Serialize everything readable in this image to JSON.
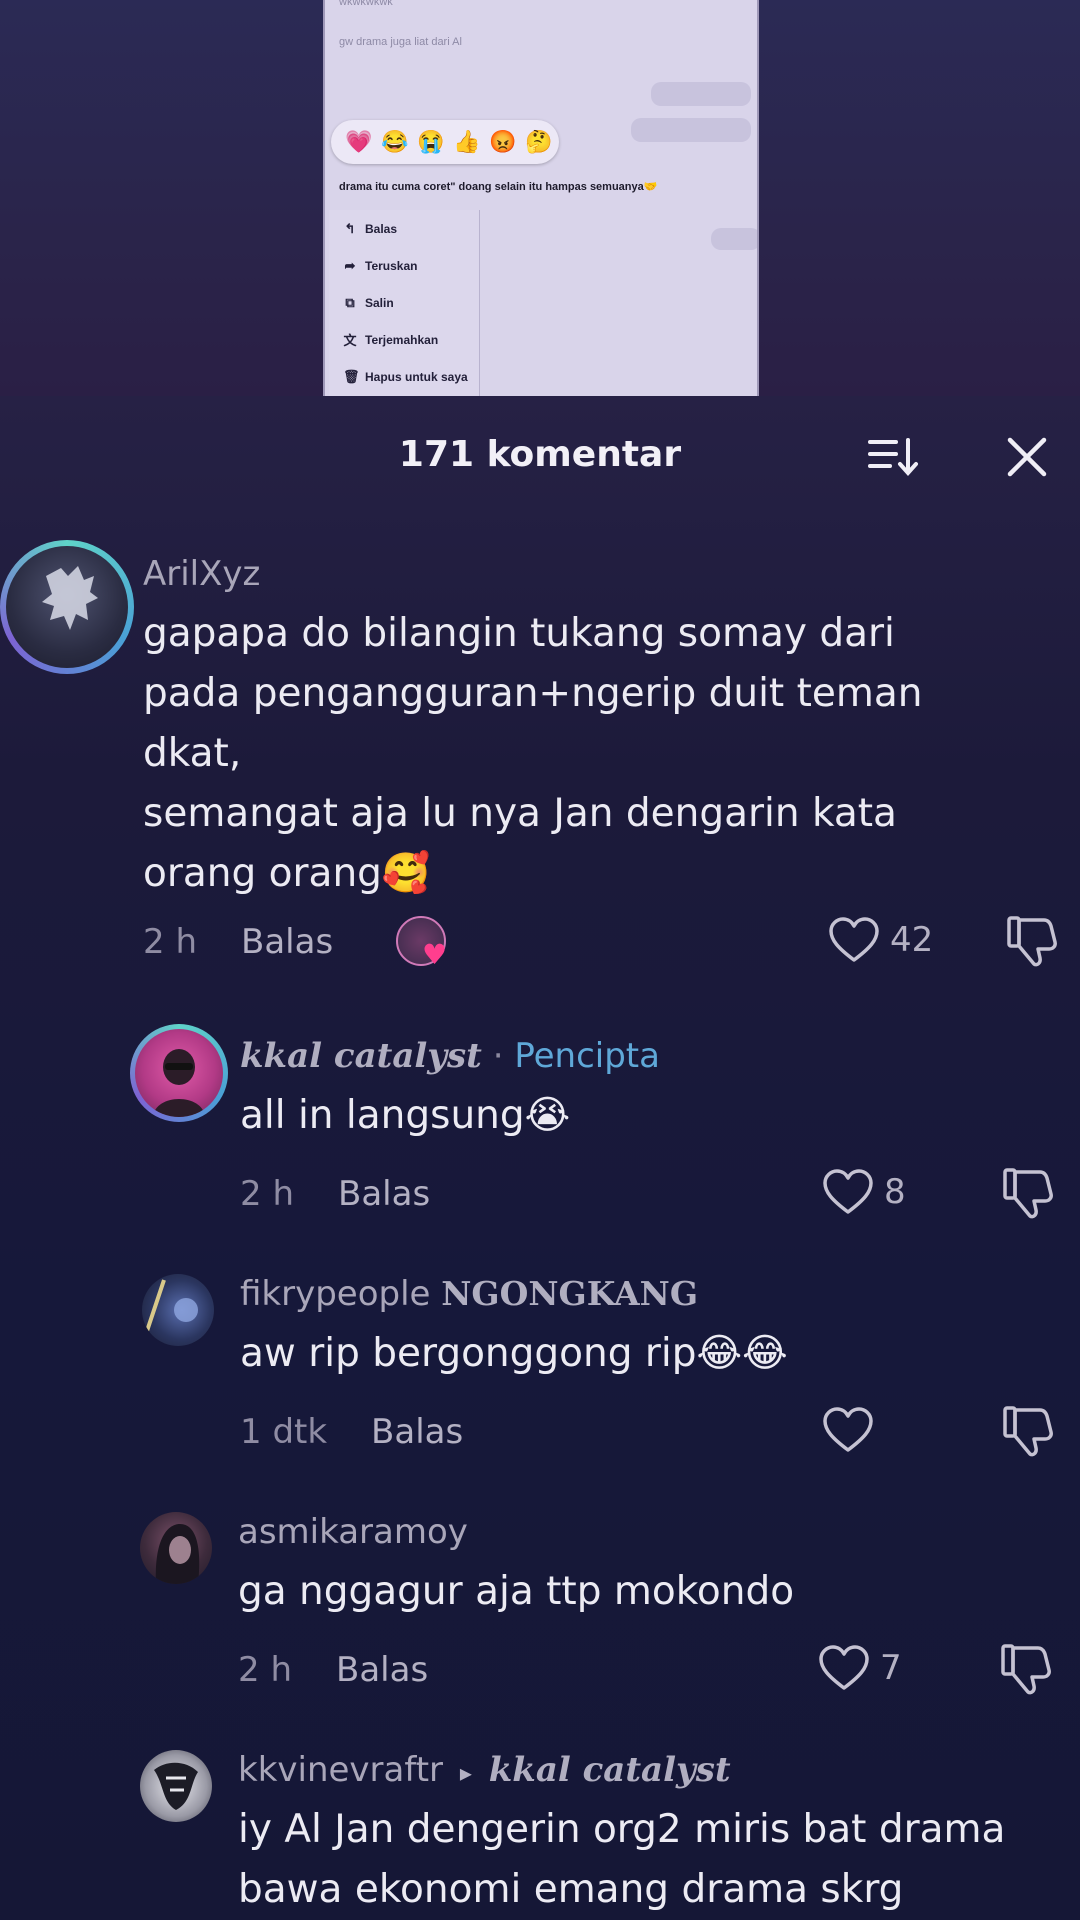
{
  "video_preview": {
    "faint_lines": [
      "wkwkwkwk",
      "gw drama juga liat dari Al"
    ],
    "right_bubbles": [
      "",
      ""
    ],
    "reactions": [
      "💗",
      "😂",
      "😭",
      "👍",
      "😡",
      "🤔"
    ],
    "message": "drama itu cuma coret\" doang selain itu hampas semuanya🤝",
    "context_menu": [
      {
        "icon": "↰",
        "label": "Balas"
      },
      {
        "icon": "➦",
        "label": "Teruskan"
      },
      {
        "icon": "⧉",
        "label": "Salin"
      },
      {
        "icon": "文",
        "label": "Terjemahkan"
      },
      {
        "icon": "🗑",
        "label": "Hapus untuk saya"
      }
    ]
  },
  "panel": {
    "title": "171 komentar"
  },
  "comments": [
    {
      "username": "ArilXyz",
      "text": "gapapa do bilangin tukang somay dari\npada pengangguran+ngerip duit teman\ndkat,\nsemangat aja lu nya Jan dengarin kata\norang orang🥰",
      "time": "2 h",
      "reply": "Balas",
      "likes": "42"
    },
    {
      "username": "kkal catalyst",
      "creator_sep": "·",
      "creator_label": "Pencipta",
      "text": "all in langsung😭",
      "time": "2 h",
      "reply": "Balas",
      "likes": "8"
    },
    {
      "username": "fikrypeople",
      "badge": "NGONGKANG",
      "text": "aw rip bergonggong rip😂😂",
      "time": "1 dtk",
      "reply": "Balas",
      "likes": ""
    },
    {
      "username": "asmikaramoy",
      "text": "ga nggagur aja ttp mokondo",
      "time": "2 h",
      "reply": "Balas",
      "likes": "7"
    },
    {
      "username": "kkvinevraftr",
      "reply_arrow": "▸",
      "reply_to": "kkal catalyst",
      "text": "iy Al Jan dengerin org2 miris bat drama\nbawa ekonomi emang drama skrg"
    }
  ],
  "colors": {
    "panel_bg": "#1c1a3a",
    "creator": "#5fa8d8",
    "heart_reaction": "#ff3e8e"
  }
}
